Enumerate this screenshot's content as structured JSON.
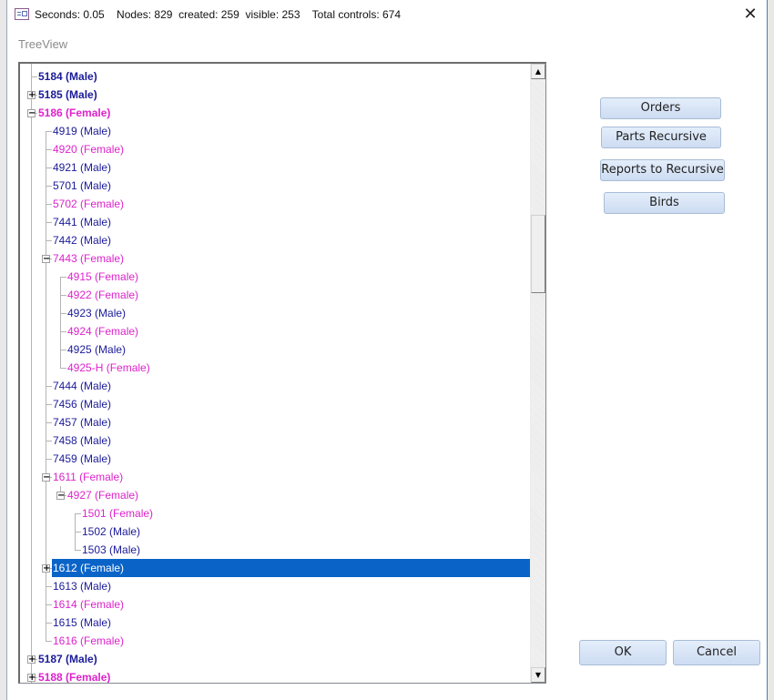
{
  "window": {
    "title": "Seconds: 0.05    Nodes: 829  created: 259  visible: 253    Total controls: 674",
    "close_icon": "✕"
  },
  "caption": "TreeView",
  "tree": {
    "nodes": [
      {
        "label": "5184 (Male)",
        "sex": "male",
        "level": 0,
        "expander": "none",
        "bold": true
      },
      {
        "label": "5185 (Male)",
        "sex": "male",
        "level": 0,
        "expander": "+",
        "bold": true
      },
      {
        "label": "5186 (Female)",
        "sex": "female",
        "level": 0,
        "expander": "-",
        "bold": true
      },
      {
        "label": "4919 (Male)",
        "sex": "male",
        "level": 1,
        "expander": "none"
      },
      {
        "label": "4920 (Female)",
        "sex": "female",
        "level": 1,
        "expander": "none"
      },
      {
        "label": "4921 (Male)",
        "sex": "male",
        "level": 1,
        "expander": "none"
      },
      {
        "label": "5701 (Male)",
        "sex": "male",
        "level": 1,
        "expander": "none"
      },
      {
        "label": "5702 (Female)",
        "sex": "female",
        "level": 1,
        "expander": "none"
      },
      {
        "label": "7441 (Male)",
        "sex": "male",
        "level": 1,
        "expander": "none"
      },
      {
        "label": "7442 (Male)",
        "sex": "male",
        "level": 1,
        "expander": "none"
      },
      {
        "label": "7443 (Female)",
        "sex": "female",
        "level": 1,
        "expander": "-"
      },
      {
        "label": "4915 (Female)",
        "sex": "female",
        "level": 2,
        "expander": "none"
      },
      {
        "label": "4922 (Female)",
        "sex": "female",
        "level": 2,
        "expander": "none"
      },
      {
        "label": "4923 (Male)",
        "sex": "male",
        "level": 2,
        "expander": "none"
      },
      {
        "label": "4924 (Female)",
        "sex": "female",
        "level": 2,
        "expander": "none"
      },
      {
        "label": "4925 (Male)",
        "sex": "male",
        "level": 2,
        "expander": "none"
      },
      {
        "label": "4925-H (Female)",
        "sex": "female",
        "level": 2,
        "expander": "none"
      },
      {
        "label": "7444 (Male)",
        "sex": "male",
        "level": 1,
        "expander": "none"
      },
      {
        "label": "7456 (Male)",
        "sex": "male",
        "level": 1,
        "expander": "none"
      },
      {
        "label": "7457 (Male)",
        "sex": "male",
        "level": 1,
        "expander": "none"
      },
      {
        "label": "7458 (Male)",
        "sex": "male",
        "level": 1,
        "expander": "none"
      },
      {
        "label": "7459 (Male)",
        "sex": "male",
        "level": 1,
        "expander": "none"
      },
      {
        "label": "1611 (Female)",
        "sex": "female",
        "level": 1,
        "expander": "-"
      },
      {
        "label": "4927 (Female)",
        "sex": "female",
        "level": 2,
        "expander": "-"
      },
      {
        "label": "1501 (Female)",
        "sex": "female",
        "level": 3,
        "expander": "none"
      },
      {
        "label": "1502 (Male)",
        "sex": "male",
        "level": 3,
        "expander": "none"
      },
      {
        "label": "1503 (Male)",
        "sex": "male",
        "level": 3,
        "expander": "none"
      },
      {
        "label": "1612 (Female)",
        "sex": "female",
        "level": 1,
        "expander": "+",
        "selected": true
      },
      {
        "label": "1613 (Male)",
        "sex": "male",
        "level": 1,
        "expander": "none"
      },
      {
        "label": "1614 (Female)",
        "sex": "female",
        "level": 1,
        "expander": "none"
      },
      {
        "label": "1615 (Male)",
        "sex": "male",
        "level": 1,
        "expander": "none"
      },
      {
        "label": "1616 (Female)",
        "sex": "female",
        "level": 1,
        "expander": "none"
      },
      {
        "label": "5187 (Male)",
        "sex": "male",
        "level": 0,
        "expander": "+",
        "bold": true
      },
      {
        "label": "5188 (Female)",
        "sex": "female",
        "level": 0,
        "expander": "+",
        "bold": true
      }
    ],
    "scroll_up_icon": "▲",
    "scroll_down_icon": "▼"
  },
  "buttons": {
    "orders": "Orders",
    "parts_recursive": "Parts Recursive",
    "reports_to_recursive": "Reports to Recursive",
    "birds": "Birds",
    "ok": "OK",
    "cancel": "Cancel"
  },
  "colors": {
    "male": "#1a1a99",
    "female": "#dd22cc",
    "selection": "#0a64c8"
  }
}
